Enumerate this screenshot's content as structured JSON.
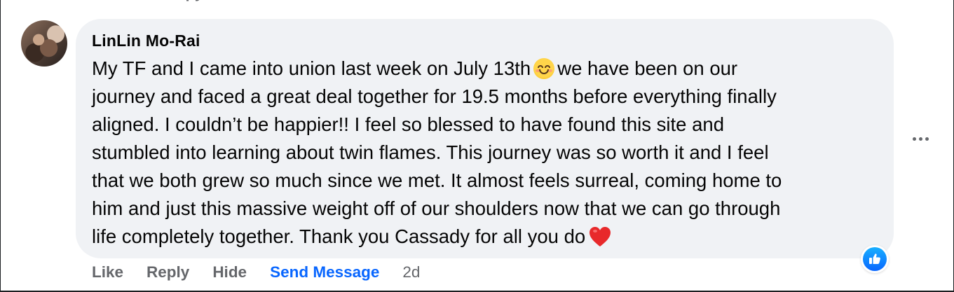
{
  "comment": {
    "author": "LinLin Mo-Rai",
    "lines": [
      [
        "My TF and I came into union last week on July 13th",
        "we have been on our"
      ],
      [
        "journey and faced a great deal together for 19.5 months before everything finally"
      ],
      [
        "aligned. I couldn’t be happier!! I feel so blessed to have found this site and"
      ],
      [
        "stumbled into learning about twin flames. This journey was so worth it and I feel"
      ],
      [
        "that we both grew so much since we met. It almost feels surreal, coming home to"
      ],
      [
        "him and just this massive weight off of our shoulders now that we can go through"
      ],
      [
        "life completely together. Thank you Cassady for all you do"
      ]
    ],
    "emojis": [
      "smiling-face-with-smiling-eyes",
      "red-heart"
    ],
    "reaction_icon": "thumbs-up-icon"
  },
  "actions": {
    "like": "Like",
    "reply": "Reply",
    "hide": "Hide",
    "send_message": "Send Message",
    "timestamp": "2d"
  },
  "colors": {
    "bubble": "#f0f2f5",
    "text": "#050505",
    "secondary": "#65676b",
    "link": "#0866ff"
  }
}
